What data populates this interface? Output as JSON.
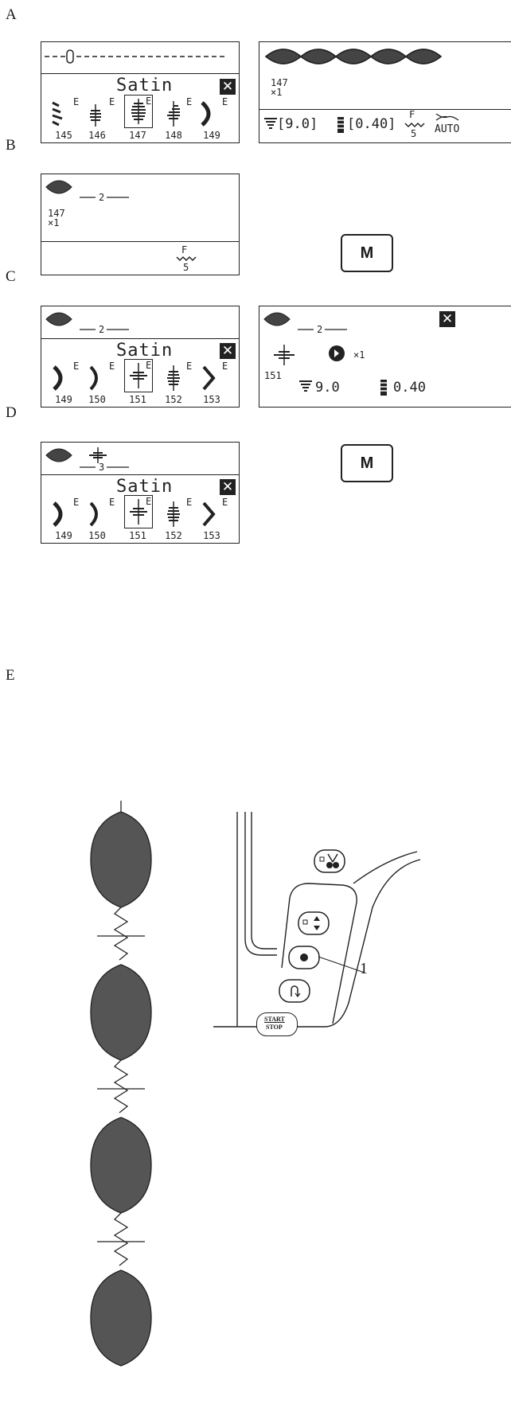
{
  "sections": {
    "a": "A",
    "b": "B",
    "c": "C",
    "d": "D",
    "e": "E"
  },
  "screen_a1": {
    "title": "Satin",
    "close": "✕",
    "stitches": [
      {
        "num": "145",
        "tag": "E"
      },
      {
        "num": "146",
        "tag": "E"
      },
      {
        "num": "147",
        "tag": "E"
      },
      {
        "num": "148",
        "tag": "E"
      },
      {
        "num": "149",
        "tag": "E"
      }
    ]
  },
  "screen_a2": {
    "pattern_num": "147",
    "repeat": "×1",
    "width_value": "[9.0]",
    "length_value": "[0.40]",
    "foot_letter": "F",
    "foot_num": "5",
    "auto_label": "AUTO"
  },
  "screen_b": {
    "memory_count": "2",
    "pattern_num": "147",
    "repeat": "×1",
    "foot_letter": "F",
    "foot_num": "5"
  },
  "m_button_b": "M",
  "screen_c1": {
    "memory_count": "2",
    "title": "Satin",
    "close": "✕",
    "stitches": [
      {
        "num": "149",
        "tag": "E"
      },
      {
        "num": "150",
        "tag": "E"
      },
      {
        "num": "151",
        "tag": "E"
      },
      {
        "num": "152",
        "tag": "E"
      },
      {
        "num": "153",
        "tag": "E"
      }
    ]
  },
  "screen_c2": {
    "memory_count": "2",
    "pattern_num": "151",
    "repeat": "×1",
    "width_value": "9.0",
    "length_value": "0.40",
    "close": "✕"
  },
  "screen_d": {
    "memory_count": "3",
    "title": "Satin",
    "close": "✕",
    "stitches": [
      {
        "num": "149",
        "tag": "E"
      },
      {
        "num": "150",
        "tag": "E"
      },
      {
        "num": "151",
        "tag": "E"
      },
      {
        "num": "152",
        "tag": "E"
      },
      {
        "num": "153",
        "tag": "E"
      }
    ]
  },
  "m_button_d": "M",
  "panel": {
    "start_label": "START",
    "stop_label": "STOP",
    "callout": "1"
  }
}
